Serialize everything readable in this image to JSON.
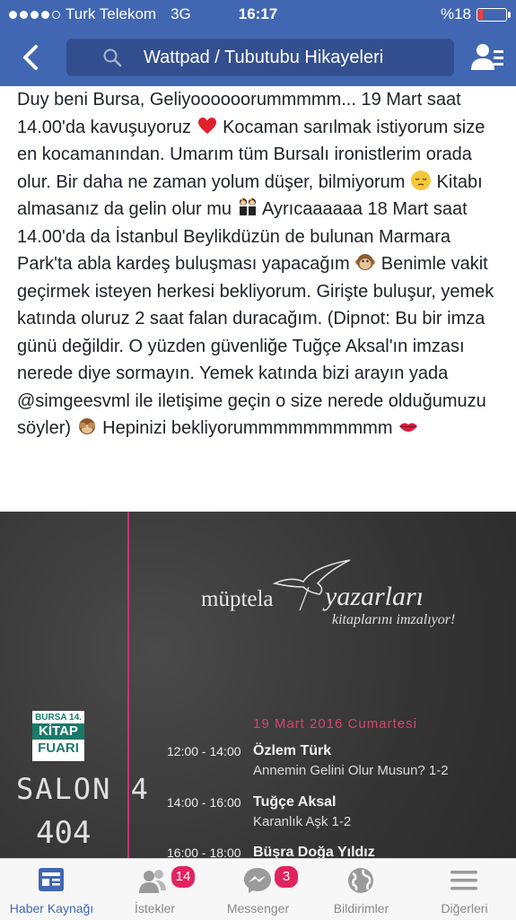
{
  "status_bar": {
    "carrier": "Turk Telekom",
    "network": "3G",
    "time": "16:17",
    "battery_percent_label": "%18",
    "battery_level": 0.18
  },
  "nav": {
    "search_text": "Wattpad / Tubutubu Hikayeleri",
    "back_icon": "chevron-left-icon",
    "friends_icon": "friend-requests-icon"
  },
  "post": {
    "p1": "Duy beni Bursa, Geliyoooooorummmmm... 19 Mart saat 14.00'da kavuşuyoruz",
    "p2": " Kocaman sarılmak istiyorum size en kocamanından. Umarım tüm Bursalı ironistlerim orada olur. Bir daha ne zaman yolum düşer, bilmiyorum",
    "p3": " Kitabı almasanız da gelin olur mu",
    "p4": " Ayrıcaaaaaa 18 Mart saat 14.00'da da İstanbul Beylikdüzün de bulunan Marmara Park'ta abla kardeş buluşması yapacağım",
    "p5": " Benimle vakit geçirmek isteyen herkesi bekliyorum. Girişte buluşur, yemek katında oluruz 2 saat falan duracağım. (Dipnot: Bu bir imza günü değildir. O yüzden güvenliğe Tuğçe Aksal'ın imzası nerede diye sormayın. Yemek katında bizi arayın yada @simgeesvml ile iletişime geçin o size nerede olduğumuzu söyler)",
    "p6": " Hepinizi bekliyorummmmmmmmmm"
  },
  "poster": {
    "brand_1": "müptela",
    "brand_2": "yazarları",
    "brand_3": "kitaplarını imzalıyor!",
    "fair_line1": "BURSA 14.",
    "fair_line2": "KİTAP",
    "fair_line3": "FUARI",
    "salon": "SALON 4",
    "salon_number": "404",
    "date": "19 Mart 2016 Cumartesi",
    "schedule": [
      {
        "time": "12:00 - 14:00",
        "author": "Özlem Türk",
        "book": "Annemin Gelini Olur Musun? 1-2"
      },
      {
        "time": "14:00 - 16:00",
        "author": "Tuğçe Aksal",
        "book": "Karanlık Aşk 1-2"
      },
      {
        "time": "16:00 - 18:00",
        "author": "Büşra Doğa Yıldız",
        "book": ""
      }
    ]
  },
  "tabs": [
    {
      "label": "Haber Kaynağı",
      "icon": "news-feed-icon",
      "active": true
    },
    {
      "label": "İstekler",
      "icon": "friend-requests-icon",
      "badge": "14"
    },
    {
      "label": "Messenger",
      "icon": "messenger-icon",
      "badge": "3"
    },
    {
      "label": "Bildirimler",
      "icon": "globe-icon"
    },
    {
      "label": "Diğerleri",
      "icon": "menu-icon"
    }
  ],
  "colors": {
    "brand_blue": "#4267b2",
    "badge_red": "#e0245e",
    "poster_pink": "#d4456f"
  }
}
